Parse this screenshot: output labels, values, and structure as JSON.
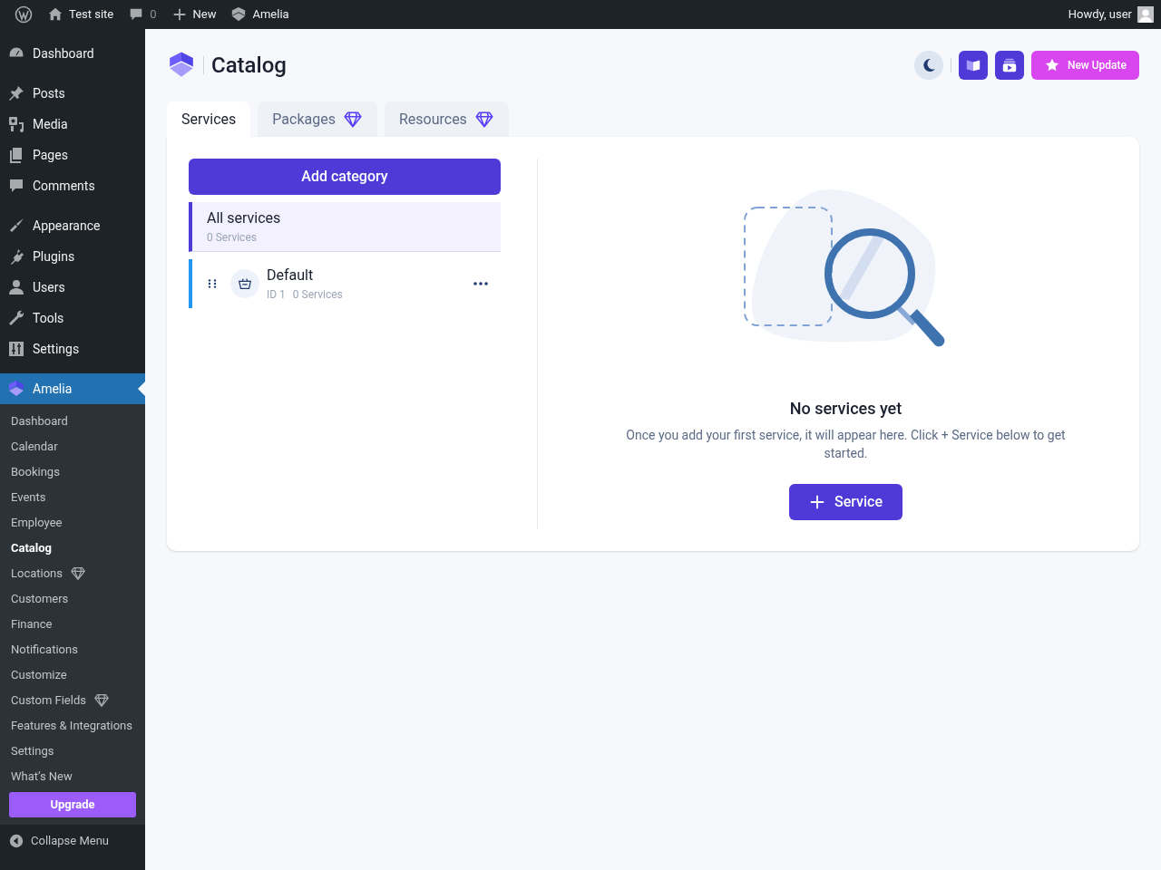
{
  "admin_bar": {
    "items": [
      {
        "kind": "wp"
      },
      {
        "kind": "home",
        "label": "Test site"
      },
      {
        "kind": "comments",
        "label": "0"
      },
      {
        "kind": "new",
        "label": "New"
      },
      {
        "kind": "amelia",
        "label": "Amelia"
      }
    ],
    "greeting": "Howdy, user"
  },
  "sidebar": {
    "groups": [
      [
        {
          "label": "Dashboard",
          "selected": false
        }
      ],
      [
        {
          "label": "Posts",
          "selected": false
        },
        {
          "label": "Media",
          "selected": false
        },
        {
          "label": "Pages",
          "selected": false
        },
        {
          "label": "Comments",
          "selected": false
        }
      ],
      [
        {
          "label": "Appearance",
          "selected": false
        },
        {
          "label": "Plugins",
          "selected": false
        },
        {
          "label": "Users",
          "selected": false
        },
        {
          "label": "Tools",
          "selected": false
        },
        {
          "label": "Settings",
          "selected": false
        }
      ],
      [
        {
          "label": "Amelia",
          "selected": true
        }
      ]
    ],
    "submenu": [
      {
        "label": "Dashboard",
        "selected": false,
        "premium": false
      },
      {
        "label": "Calendar",
        "selected": false,
        "premium": false
      },
      {
        "label": "Bookings",
        "selected": false,
        "premium": false
      },
      {
        "label": "Events",
        "selected": false,
        "premium": false
      },
      {
        "label": "Employee",
        "selected": false,
        "premium": false
      },
      {
        "label": "Catalog",
        "selected": true,
        "premium": false
      },
      {
        "label": "Locations",
        "selected": false,
        "premium": true
      },
      {
        "label": "Customers",
        "selected": false,
        "premium": false
      },
      {
        "label": "Finance",
        "selected": false,
        "premium": false
      },
      {
        "label": "Notifications",
        "selected": false,
        "premium": false
      },
      {
        "label": "Customize",
        "selected": false,
        "premium": false
      },
      {
        "label": "Custom Fields",
        "selected": false,
        "premium": true
      },
      {
        "label": "Features & Integrations",
        "selected": false,
        "premium": false
      },
      {
        "label": "Settings",
        "selected": false,
        "premium": false
      },
      {
        "label": "What’s New",
        "selected": false,
        "premium": false
      }
    ],
    "upgrade_button": "Upgrade",
    "collapse": "Collapse Menu"
  },
  "page": {
    "title": "Catalog",
    "new_update_button": "New Update",
    "tabs": [
      {
        "label": "Services",
        "selected": true,
        "premium": false
      },
      {
        "label": "Packages",
        "selected": false,
        "premium": true
      },
      {
        "label": "Resources",
        "selected": false,
        "premium": true
      }
    ],
    "add_category_button": "Add category",
    "all_services": {
      "name": "All services",
      "count": "0 Services",
      "selected": true
    },
    "categories": [
      {
        "name": "Default",
        "id": "ID 1",
        "count": "0 Services",
        "selected": false
      }
    ],
    "empty_state": {
      "title": "No services yet",
      "text": "Once you add your first service, it will appear here. Click + Service below to get started.",
      "button": "Service"
    }
  }
}
